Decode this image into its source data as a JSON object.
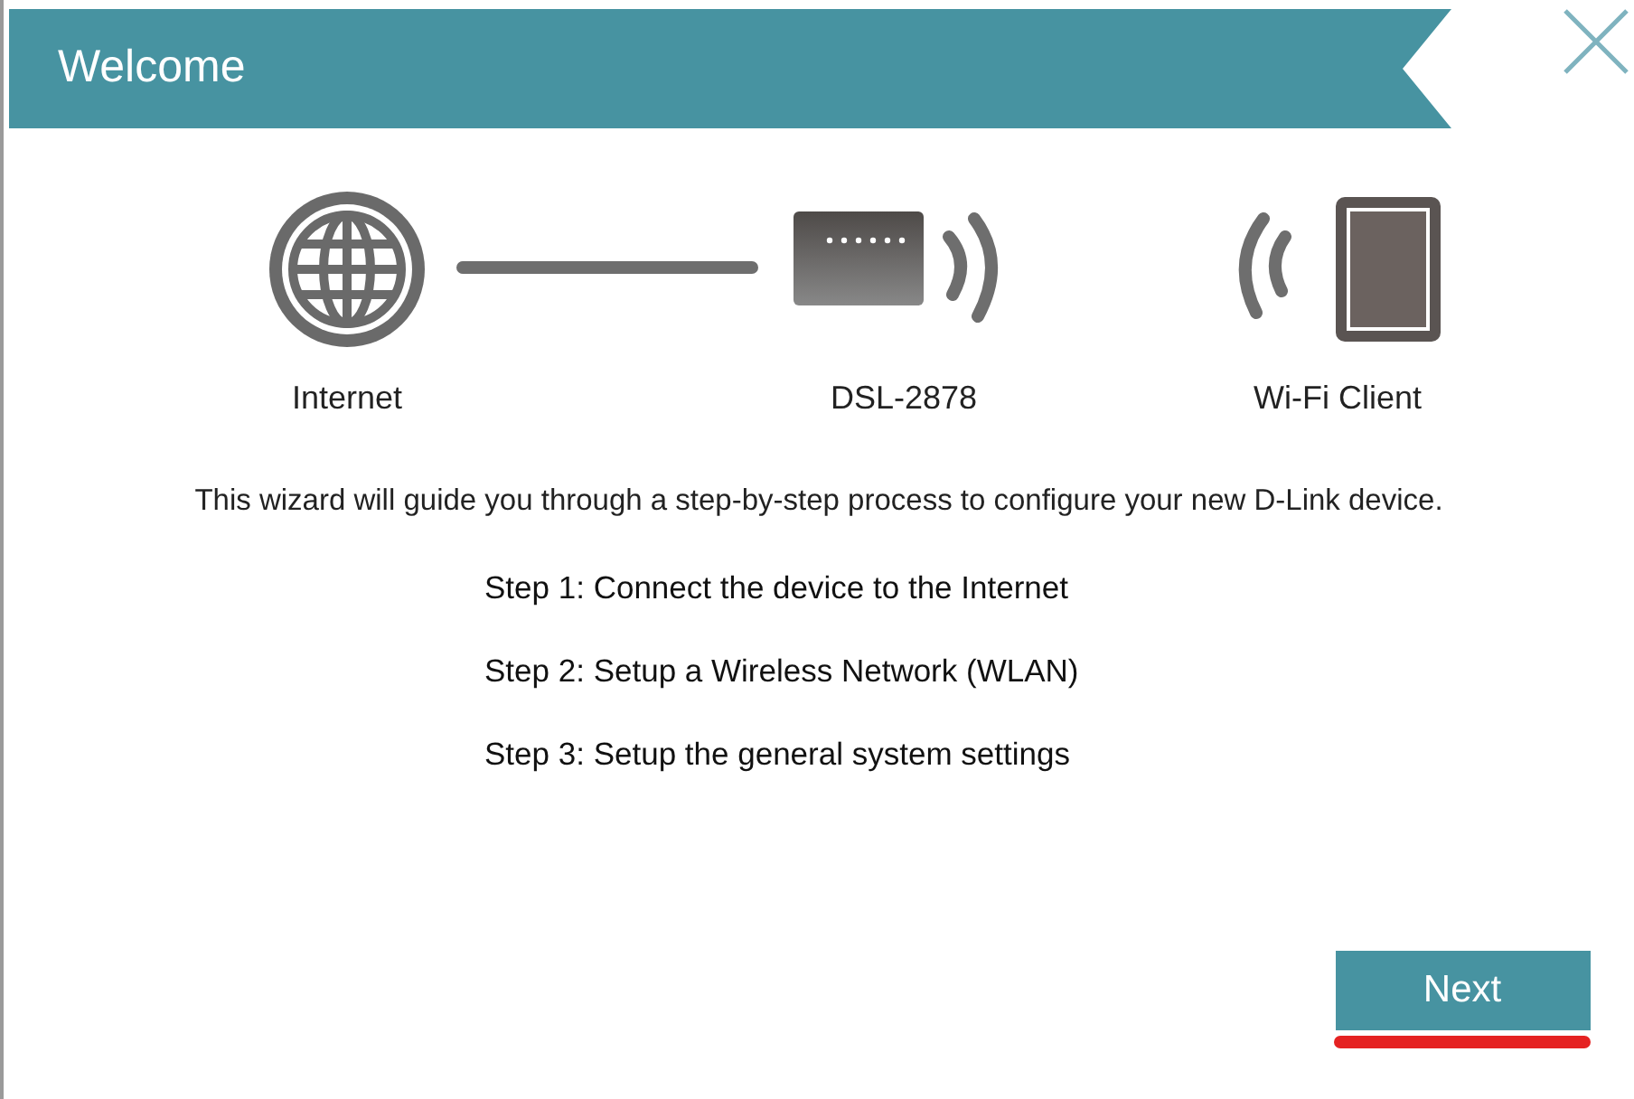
{
  "header": {
    "title": "Welcome"
  },
  "diagram": [
    {
      "kind": "globe",
      "label": "Internet"
    },
    {
      "kind": "router",
      "label": "DSL-2878"
    },
    {
      "kind": "tablet",
      "label": "Wi-Fi Client"
    }
  ],
  "description": "This wizard will guide you through a step-by-step process to configure your new D-Link device.",
  "steps": [
    "Step 1: Connect the device to the Internet",
    "Step 2: Setup a Wireless Network (WLAN)",
    "Step 3: Setup the general system settings"
  ],
  "next_button": {
    "label": "Next",
    "highlighted": true
  }
}
